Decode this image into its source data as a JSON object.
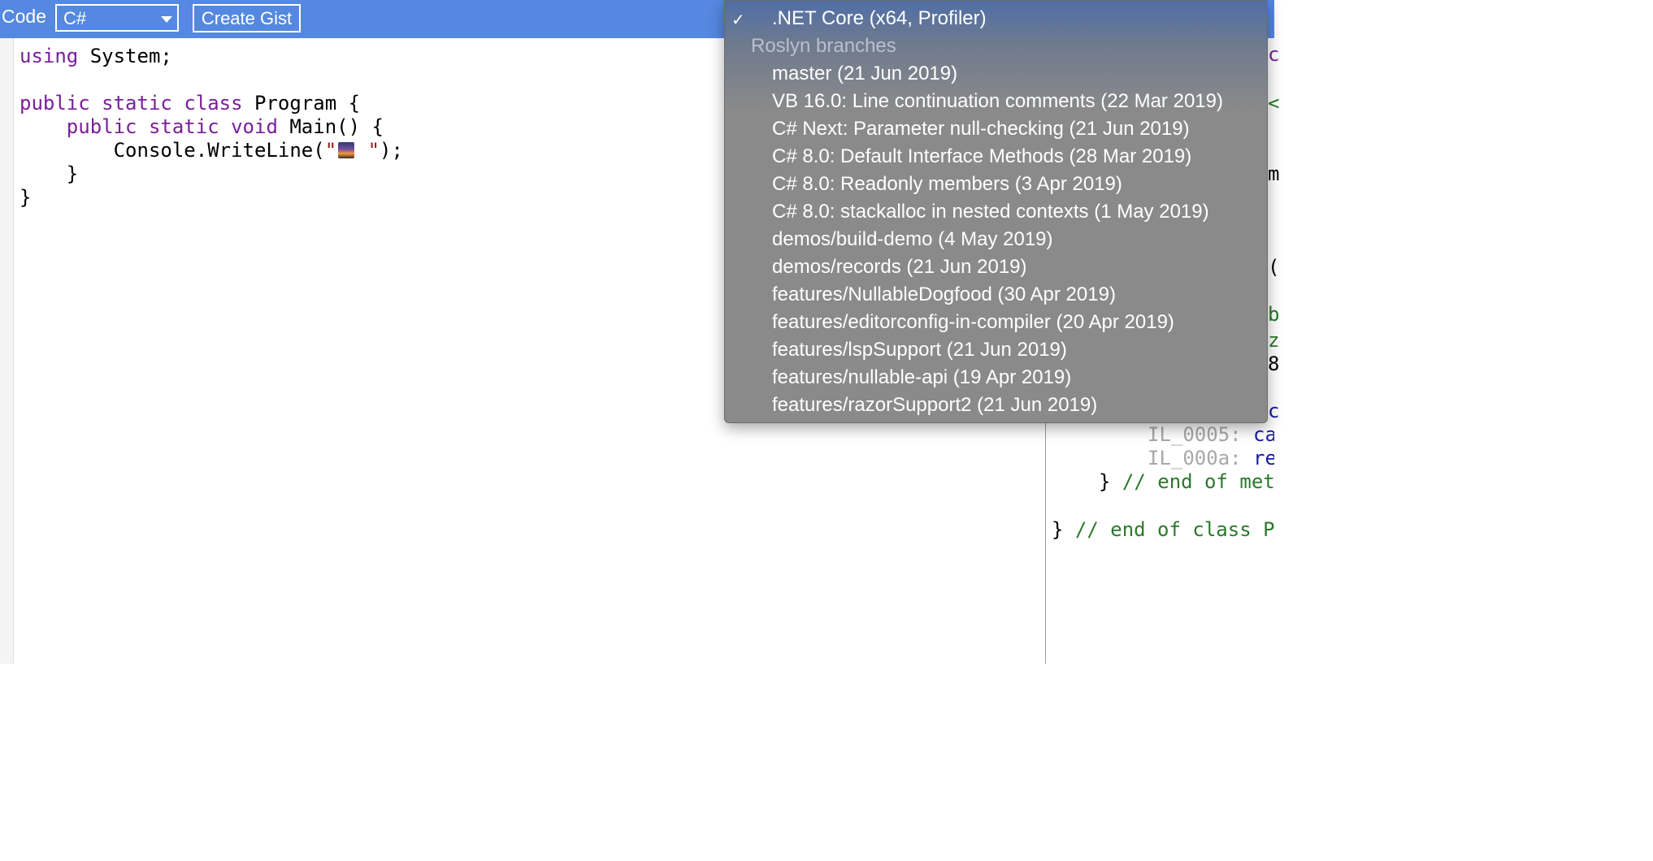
{
  "toolbar": {
    "code_label": "Code",
    "language_value": "C#",
    "create_gist_label": "Create Gist"
  },
  "editor": {
    "line1_kw": "using",
    "line1_rest": " System;",
    "line3_kw1": "public",
    "line3_kw2": "static",
    "line3_kw3": "class",
    "line3_rest": " Program {",
    "line4_indent": "    ",
    "line4_kw1": "public",
    "line4_kw2": "static",
    "line4_kw3": "void",
    "line4_rest": " Main() {",
    "line5_prefix": "        Console.WriteLine(",
    "line5_str_open": "\"",
    "line5_str_close": " \"",
    "line5_suffix": ");",
    "line6": "    }",
    "line7": "}"
  },
  "output": {
    "il1_num": "IL_0005:",
    "il1_op": " ca",
    "il2_num": "IL_000a:",
    "il2_op": " re",
    "end_method_brace": "} ",
    "end_method_comment": "// end of met",
    "end_class_brace": "} ",
    "end_class_comment": "// end of class P"
  },
  "dropdown": {
    "selected": ".NET Core (x64, Profiler)",
    "group_label": "Roslyn branches",
    "items": [
      "master (21 Jun 2019)",
      "VB 16.0: Line continuation comments (22 Mar 2019)",
      "C# Next: Parameter null-checking (21 Jun 2019)",
      "C# 8.0: Default Interface Methods (28 Mar 2019)",
      "C# 8.0: Readonly members (3 Apr 2019)",
      "C# 8.0: stackalloc in nested contexts (1 May 2019)",
      "demos/build-demo (4 May 2019)",
      "demos/records (21 Jun 2019)",
      "features/NullableDogfood (30 Apr 2019)",
      "features/editorconfig-in-compiler (20 Apr 2019)",
      "features/lspSupport (21 Jun 2019)",
      "features/nullable-api (19 Apr 2019)",
      "features/razorSupport2 (21 Jun 2019)"
    ]
  },
  "edge_glyphs": [
    "c",
    "<",
    "m",
    "(",
    "b",
    "z",
    "8",
    "c"
  ],
  "colors": {
    "toolbar": "#5588e0",
    "keyword": "#7a1f9a",
    "string": "#a31515",
    "comment": "#2a7a2a"
  }
}
